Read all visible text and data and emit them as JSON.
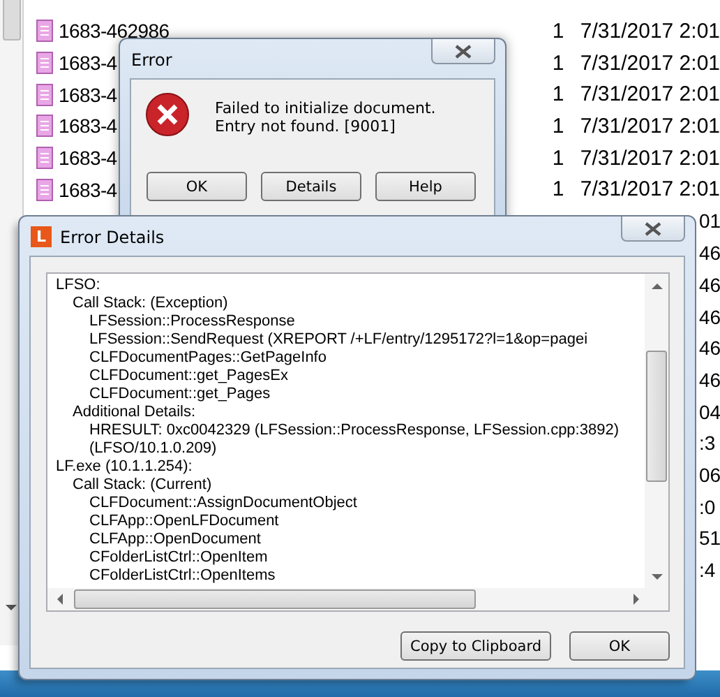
{
  "file_list": {
    "rows": [
      {
        "name": "1683-462986",
        "count": "1",
        "date": "7/31/2017 2:01"
      },
      {
        "name": "1683-4",
        "count": "1",
        "date": "7/31/2017 2:01"
      },
      {
        "name": "1683-4",
        "count": "1",
        "date": "7/31/2017 2:01"
      },
      {
        "name": "1683-4",
        "count": "1",
        "date": "7/31/2017 2:01"
      },
      {
        "name": "1683-4",
        "count": "1",
        "date": "7/31/2017 2:01"
      },
      {
        "name": "1683-4",
        "count": "1",
        "date": "7/31/2017 2:01"
      }
    ],
    "cut_column": [
      "01",
      "46",
      "46",
      "46",
      "46",
      "46",
      "04",
      ":3",
      "06",
      ":0",
      "51",
      ":4"
    ]
  },
  "error_dialog": {
    "title": "Error",
    "message": [
      "Failed to initialize document.",
      "Entry not found. [9001]"
    ],
    "buttons": [
      "OK",
      "Details",
      "Help"
    ]
  },
  "details_dialog": {
    "title": "Error Details",
    "app_icon": "L",
    "lines": [
      {
        "text": "LFSO:",
        "children": [
          {
            "text": "Call Stack: (Exception)",
            "children": [
              {
                "text": "LFSession::ProcessResponse"
              },
              {
                "text": "LFSession::SendRequest (XREPORT /+LF/entry/1295172?l=1&op=pagei"
              },
              {
                "text": "CLFDocumentPages::GetPageInfo"
              },
              {
                "text": "CLFDocument::get_PagesEx"
              },
              {
                "text": "CLFDocument::get_Pages"
              }
            ]
          },
          {
            "text": "Additional Details:",
            "children": [
              {
                "text": "HRESULT: 0xc0042329 (LFSession::ProcessResponse, LFSession.cpp:3892)"
              },
              {
                "text": "(LFSO/10.1.0.209)"
              }
            ]
          }
        ]
      },
      {
        "text": "LF.exe (10.1.1.254):",
        "children": [
          {
            "text": "Call Stack: (Current)",
            "children": [
              {
                "text": "CLFDocument::AssignDocumentObject"
              },
              {
                "text": "CLFApp::OpenLFDocument"
              },
              {
                "text": "CLFApp::OpenDocument"
              },
              {
                "text": "CFolderListCtrl::OpenItem"
              },
              {
                "text": "CFolderListCtrl::OpenItems"
              }
            ]
          }
        ]
      }
    ],
    "buttons": [
      "Copy to Clipboard",
      "OK"
    ]
  }
}
